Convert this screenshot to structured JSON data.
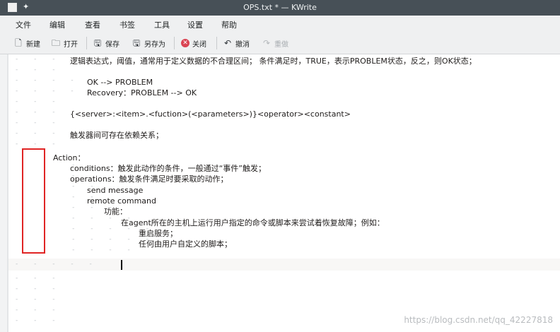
{
  "window": {
    "title": "OPS.txt * — KWrite"
  },
  "menu": [
    "文件",
    "编辑",
    "查看",
    "书签",
    "工具",
    "设置",
    "帮助"
  ],
  "toolbar": {
    "new": "新建",
    "open": "打开",
    "save": "保存",
    "save_as": "另存为",
    "close": "关闭",
    "undo": "撤消",
    "redo": "重做"
  },
  "editor": {
    "lines": [
      "逻辑表达式，阈值，通常用于定义数据的不合理区间； 条件满足时，TRUE，表示PROBLEM状态，反之，则OK状态；",
      "",
      "OK --> PROBLEM",
      "Recovery：PROBLEM --> OK",
      "",
      "{<server>:<item>.<fuction>(<parameters>)}<operator><constant>",
      "",
      "触发器间可存在依赖关系；",
      "",
      "Action：",
      "conditions：触发此动作的条件，一般通过“事件”触发；",
      "operations：触发条件满足时要采取的动作；",
      "send message",
      "remote command",
      "功能：",
      "在agent所在的主机上运行用户指定的命令或脚本来尝试着恢复故障；例如：",
      "重启服务；",
      "任何由用户自定义的脚本；",
      "",
      ""
    ]
  },
  "watermark": "https://blog.csdn.net/qq_42227818"
}
